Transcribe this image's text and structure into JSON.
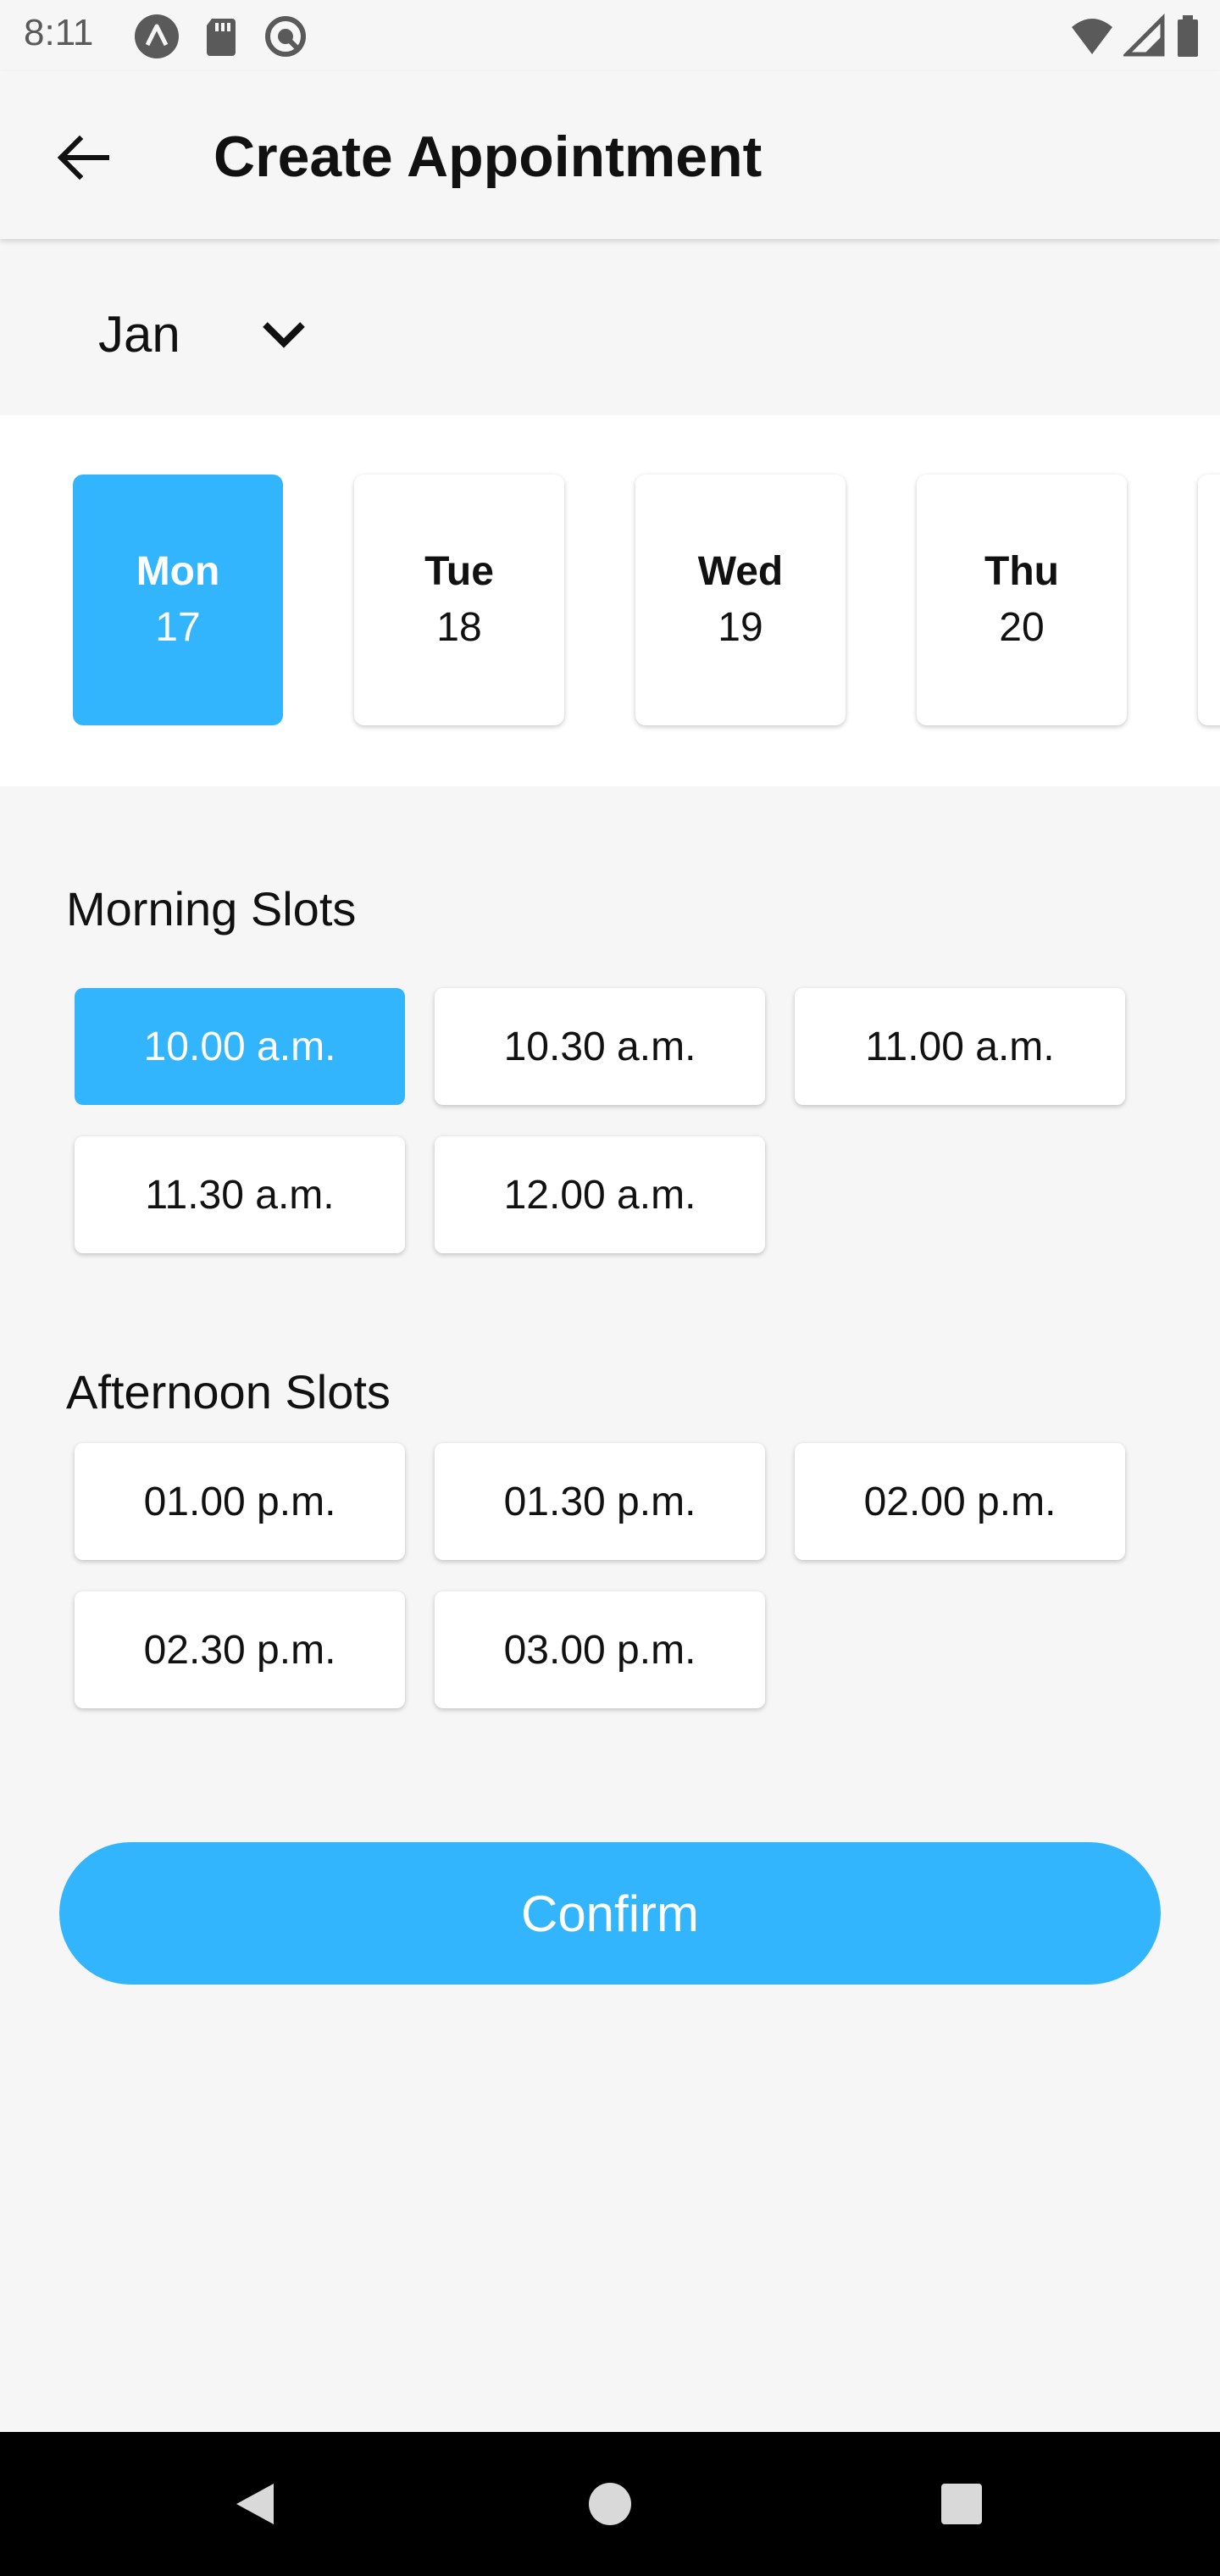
{
  "status_bar": {
    "time": "8:11",
    "left_icons": [
      "assistant-icon",
      "sd-card-icon",
      "data-saver-icon"
    ],
    "right_icons": [
      "wifi-icon",
      "signal-icon",
      "battery-icon"
    ]
  },
  "app_bar": {
    "title": "Create Appointment",
    "back_icon": "arrow-back-icon"
  },
  "month": {
    "label": "Jan",
    "icon": "chevron-down-icon"
  },
  "days": [
    {
      "name": "Mon",
      "num": "17",
      "selected": true
    },
    {
      "name": "Tue",
      "num": "18",
      "selected": false
    },
    {
      "name": "Wed",
      "num": "19",
      "selected": false
    },
    {
      "name": "Thu",
      "num": "20",
      "selected": false
    }
  ],
  "morning": {
    "title": "Morning Slots",
    "slots": [
      {
        "label": "10.00 a.m.",
        "selected": true
      },
      {
        "label": "10.30 a.m.",
        "selected": false
      },
      {
        "label": "11.00 a.m.",
        "selected": false
      },
      {
        "label": "11.30 a.m.",
        "selected": false
      },
      {
        "label": "12.00 a.m.",
        "selected": false
      }
    ]
  },
  "afternoon": {
    "title": "Afternoon Slots",
    "slots": [
      {
        "label": "01.00 p.m.",
        "selected": false
      },
      {
        "label": "01.30 p.m.",
        "selected": false
      },
      {
        "label": "02.00 p.m.",
        "selected": false
      },
      {
        "label": "02.30 p.m.",
        "selected": false
      },
      {
        "label": "03.00 p.m.",
        "selected": false
      }
    ]
  },
  "confirm_label": "Confirm",
  "nav_bar": {
    "icons": [
      "nav-back-icon",
      "nav-home-icon",
      "nav-recents-icon"
    ]
  },
  "colors": {
    "accent": "#33b5fd",
    "background": "#f6f6f6",
    "card": "#ffffff",
    "nav_bar": "#000000"
  }
}
